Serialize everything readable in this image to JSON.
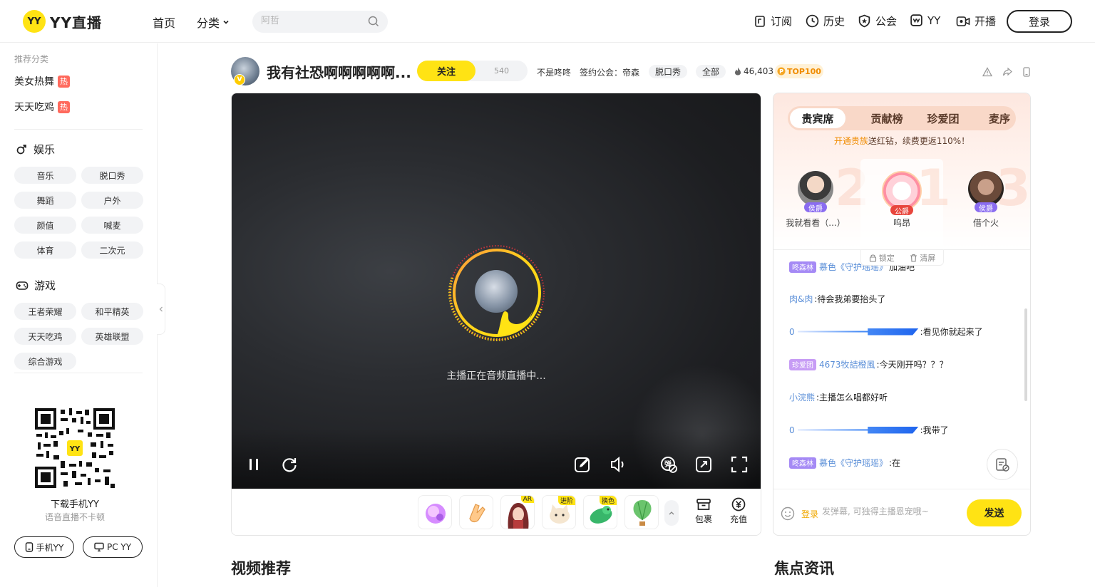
{
  "header": {
    "logo_badge": "YY",
    "logo_text": "YY直播",
    "nav_home": "首页",
    "nav_category": "分类",
    "search_placeholder": "阿哲",
    "subscribe": "订阅",
    "history": "历史",
    "guild": "公会",
    "yy": "YY",
    "broadcast": "开播",
    "login": "登录"
  },
  "sidebar": {
    "recommend_label": "推荐分类",
    "hot_items": [
      {
        "label": "美女热舞",
        "tag": "热"
      },
      {
        "label": "天天吃鸡",
        "tag": "热"
      }
    ],
    "entertainment": {
      "title": "娱乐",
      "items": [
        "音乐",
        "脱口秀",
        "舞蹈",
        "户外",
        "颜值",
        "喊麦",
        "体育",
        "二次元"
      ]
    },
    "games": {
      "title": "游戏",
      "items": [
        "王者荣耀",
        "和平精英",
        "天天吃鸡",
        "英雄联盟",
        "综合游戏"
      ]
    },
    "download_title": "下载手机YY",
    "download_sub": "语音直播不卡顿",
    "mobile_btn": "手机YY",
    "pc_btn": "PC YY"
  },
  "room": {
    "title": "我有社恐啊啊啊啊啊...",
    "follow": "关注",
    "follow_count": "540",
    "anchor": "不是咚咚",
    "guild": "签约公会：帝森",
    "tag_talk": "脱口秀",
    "tag_all": "全部",
    "hot_value": "46,403",
    "top": "TOP100"
  },
  "player": {
    "status_text": "主播正在音频直播中...",
    "gifts": [
      {
        "name": "gift-1",
        "tag": ""
      },
      {
        "name": "gift-2",
        "tag": ""
      },
      {
        "name": "gift-3",
        "tag": "AR"
      },
      {
        "name": "gift-4",
        "tag": "进阶"
      },
      {
        "name": "gift-5",
        "tag": "换色"
      },
      {
        "name": "gift-6",
        "tag": ""
      }
    ],
    "bag": "包裹",
    "recharge": "充值"
  },
  "panel": {
    "tabs": [
      "贵宾席",
      "贡献榜",
      "珍爱团",
      "麦序"
    ],
    "tip_highlight": "开通贵族",
    "tip_rest": "送红钻，续费更返110%！",
    "seats": [
      {
        "name": "我就看看（...）",
        "badge": "侯爵",
        "rank": "2"
      },
      {
        "name": "呜昂",
        "badge": "公爵",
        "rank": "1"
      },
      {
        "name": "借个火",
        "badge": "侯爵",
        "rank": "3"
      }
    ],
    "lock": "锁定",
    "clear": "清屏",
    "messages": [
      {
        "badge": "咚森林",
        "nick": "慕色《守护瑶瑶》",
        "text": "加油吧"
      },
      {
        "badge": "",
        "nick": "肉&肉",
        "text": ":待会我弟要抬头了"
      },
      {
        "badge": "",
        "nick": "0",
        "text": ":看见你就起来了"
      },
      {
        "badge": "珍爱团",
        "nick": "4673牧詰橙風",
        "text": ":今天刚开吗？？？"
      },
      {
        "badge": "",
        "nick": "小浣熊",
        "text": ":主播怎么唱都好听"
      },
      {
        "badge": "",
        "nick": "0",
        "text": ":我带了"
      },
      {
        "badge": "咚森林",
        "nick": "慕色《守护瑶瑶》",
        "text": ":在"
      }
    ],
    "input_login": "登录",
    "input_placeholder": "发弹幕, 可独得主播恩宠哦~",
    "send": "发送"
  },
  "sections": {
    "video_rec": "视频推荐",
    "focus_news": "焦点资讯"
  },
  "colors": {
    "brand_yellow": "#ffe314",
    "nick_blue": "#5b8fd8",
    "hot_red": "#ff6a5d"
  }
}
